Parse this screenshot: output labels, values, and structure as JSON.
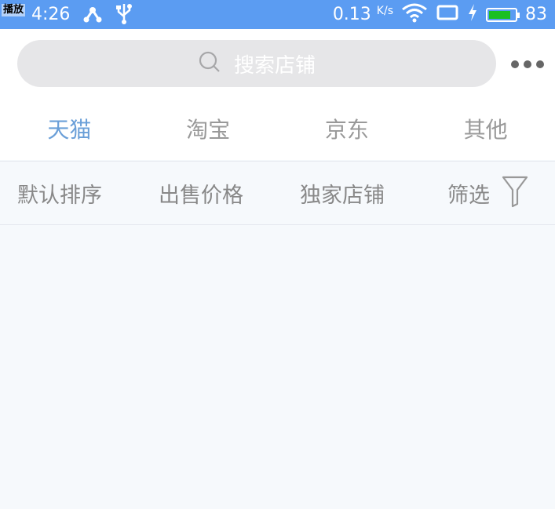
{
  "statusbar": {
    "badge": "播放",
    "time": "4:26",
    "speed": "0.13",
    "speed_unit": "K/s",
    "battery": "83",
    "battery_level_pct": 83,
    "battery_color": "#1bbf22",
    "bg_color": "#5b9cf2"
  },
  "search": {
    "placeholder": "搜索店铺"
  },
  "tabs": [
    {
      "label": "天猫",
      "active": true
    },
    {
      "label": "淘宝"
    },
    {
      "label": "京东"
    },
    {
      "label": "其他"
    }
  ],
  "filters": {
    "sort_default": "默认排序",
    "price": "出售价格",
    "exclusive": "独家店铺",
    "filter": "筛选"
  },
  "icons": {
    "search": "search-icon",
    "more": "more-dots-icon",
    "filter": "funnel-icon",
    "wifi": "wifi-icon",
    "usb": "usb-icon",
    "share": "share-icon"
  }
}
